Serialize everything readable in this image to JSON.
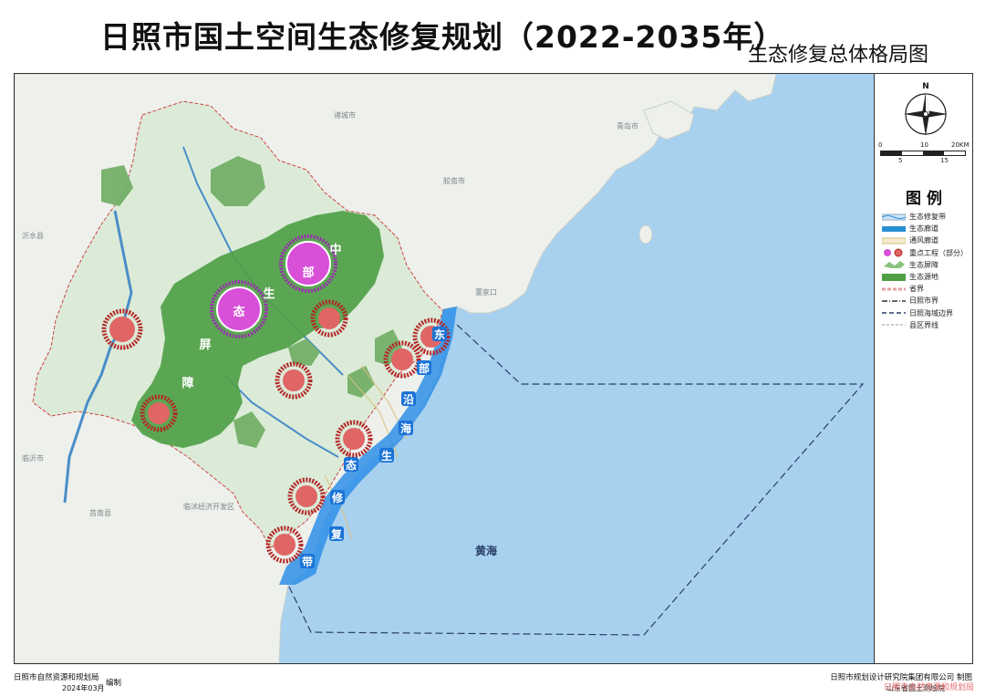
{
  "title": "日照市国土空间生态修复规划（2022-2035年）",
  "subtitle": "生态修复总体格局图",
  "map": {
    "place_labels": [
      "诸城市",
      "青岛市",
      "胶南市",
      "沂水县",
      "临沂市",
      "临沭经济开发区",
      "莒南县",
      "董家口",
      "黄海"
    ],
    "zone_labels": {
      "central": [
        "中",
        "部",
        "生",
        "态",
        "屏",
        "障"
      ],
      "east": [
        "东",
        "部",
        "沿",
        "海",
        "生",
        "态",
        "修",
        "复",
        "带"
      ]
    },
    "sea_label": "黄海",
    "colors": {
      "sea": "#a8d1f0",
      "land": "#eef0ec",
      "rizhao_land": "#dcebd8",
      "barrier": "#4f9f47",
      "source": "#73b068",
      "belt": "#2f8fe8",
      "project": "#e06565",
      "project_ring": "#b22828",
      "core": "#d84fd8"
    }
  },
  "compass": {
    "north": "N"
  },
  "scale": {
    "ticks": [
      "0",
      "10",
      "20KM"
    ],
    "subticks": [
      "5",
      "15"
    ]
  },
  "legend": {
    "title": "图 例",
    "items": [
      {
        "label": "生态修复带",
        "symbol": "restore-belt-symbol"
      },
      {
        "label": "生态廊道",
        "symbol": "eco-corridor-symbol"
      },
      {
        "label": "通风廊道",
        "symbol": "vent-corridor-symbol"
      },
      {
        "label": "重点工程（部分）",
        "symbol": "key-project-symbol"
      },
      {
        "label": "生态屏障",
        "symbol": "eco-barrier-symbol"
      },
      {
        "label": "生态源地",
        "symbol": "eco-source-symbol"
      },
      {
        "label": "省界",
        "symbol": "province-boundary-symbol"
      },
      {
        "label": "日照市界",
        "symbol": "city-boundary-symbol"
      },
      {
        "label": "日照海域边界",
        "symbol": "sea-boundary-symbol"
      },
      {
        "label": "县区界线",
        "symbol": "county-boundary-symbol"
      }
    ]
  },
  "footer": {
    "left_org": "日照市自然资源和规划局",
    "left_date": "2024年03月",
    "left_action": "编制",
    "right_org": "日照市规划设计研究院集团有限公司  制图",
    "right_org2": "山东省国土测绘院",
    "watermark": "日照市自然资源和规划局"
  }
}
